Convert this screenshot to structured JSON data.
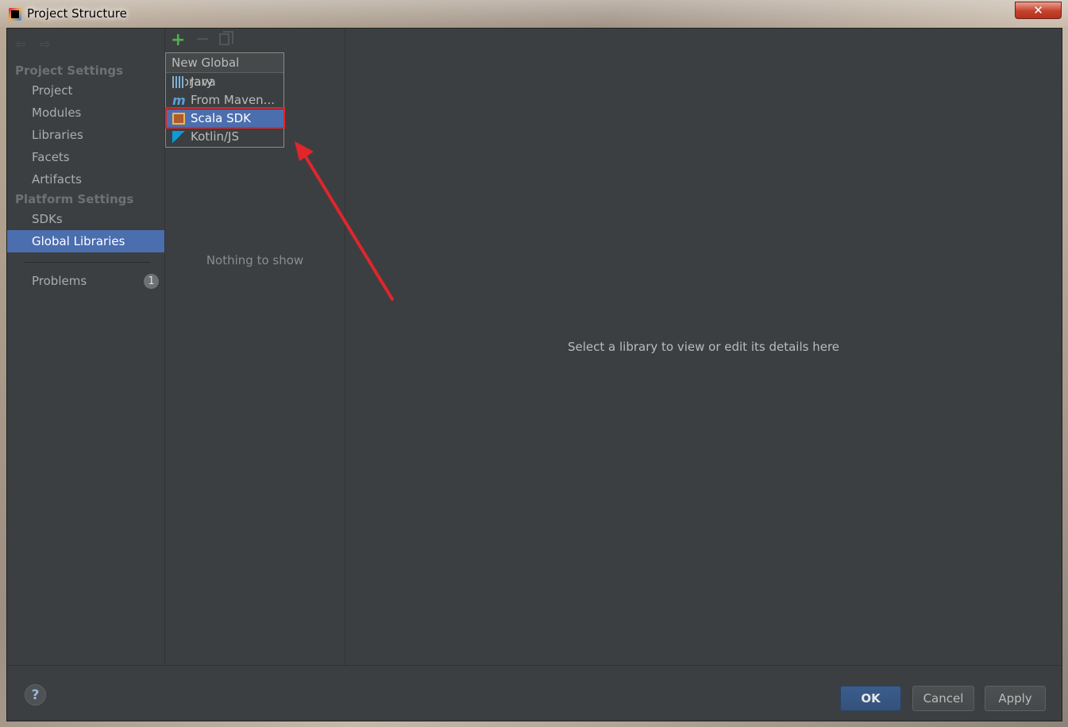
{
  "window": {
    "title": "Project Structure",
    "close_label": "✕"
  },
  "sidebar": {
    "project_settings_header": "Project Settings",
    "project_items": [
      {
        "label": "Project"
      },
      {
        "label": "Modules"
      },
      {
        "label": "Libraries"
      },
      {
        "label": "Facets"
      },
      {
        "label": "Artifacts"
      }
    ],
    "platform_settings_header": "Platform Settings",
    "platform_items": [
      {
        "label": "SDKs"
      },
      {
        "label": "Global Libraries",
        "selected": true
      }
    ],
    "problems": {
      "label": "Problems",
      "count": "1"
    }
  },
  "middle": {
    "empty_text": "Nothing to show"
  },
  "popup": {
    "title": "New Global Library",
    "items": [
      {
        "label": "Java",
        "icon": "java-library-icon"
      },
      {
        "label": "From Maven...",
        "icon": "maven-icon"
      },
      {
        "label": "Scala SDK",
        "icon": "scala-sdk-icon",
        "selected": true
      },
      {
        "label": "Kotlin/JS",
        "icon": "kotlin-icon"
      }
    ]
  },
  "details": {
    "placeholder": "Select a library to view or edit its details here"
  },
  "footer": {
    "help_label": "?",
    "ok_label": "OK",
    "cancel_label": "Cancel",
    "apply_label": "Apply"
  },
  "colors": {
    "background": "#3c3f41",
    "selection": "#4b6eaf",
    "annotation": "#e0262b"
  }
}
